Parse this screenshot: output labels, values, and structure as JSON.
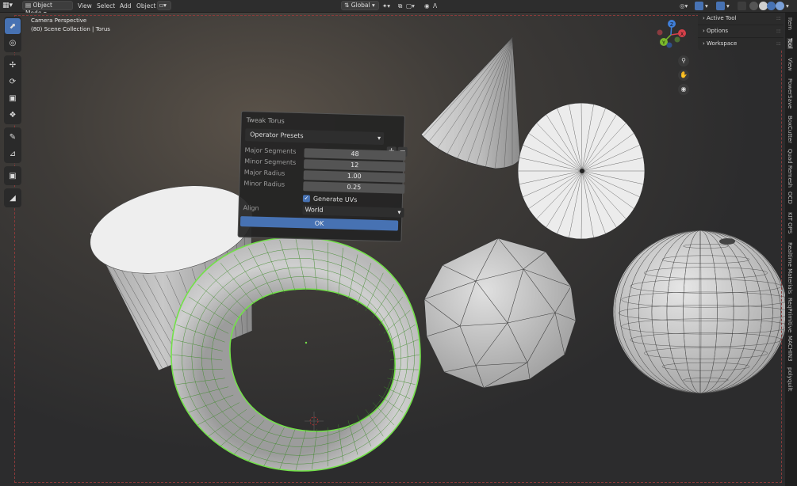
{
  "header": {
    "mode": "Object Mode",
    "menus": [
      "View",
      "Select",
      "Add",
      "Object"
    ],
    "transform_orientation": "Global"
  },
  "viewport": {
    "view_name": "Camera Perspective",
    "collection_info": "(80) Scene Collection | Torus",
    "accent_color": "#4772b3",
    "selection_color": "#73e04a"
  },
  "n_panel": {
    "sections": [
      "Active Tool",
      "Options",
      "Workspace"
    ]
  },
  "side_tabs": [
    "Item",
    "Tool",
    "View",
    "PowerSave",
    "BoxCutter",
    "Quad Remesh",
    "OCD",
    "KIT OPS",
    "Realtime Materials",
    "ReqPrimitive",
    "MACHIN3",
    "polyquilt"
  ],
  "redo_panel": {
    "title": "Tweak Torus",
    "presets_label": "Operator Presets",
    "fields": [
      {
        "label": "Major Segments",
        "value": "48"
      },
      {
        "label": "Minor Segments",
        "value": "12"
      },
      {
        "label": "Major Radius",
        "value": "1.00"
      },
      {
        "label": "Minor Radius",
        "value": "0.25"
      }
    ],
    "generate_uvs_label": "Generate UVs",
    "generate_uvs": true,
    "align_label": "Align",
    "align_value": "World",
    "ok_label": "OK"
  },
  "gizmo": {
    "x_label": "X",
    "y_label": "Y",
    "z_label": "Z",
    "x_color": "#d6404a",
    "y_color": "#7ab82b",
    "z_color": "#3f7fd8"
  }
}
